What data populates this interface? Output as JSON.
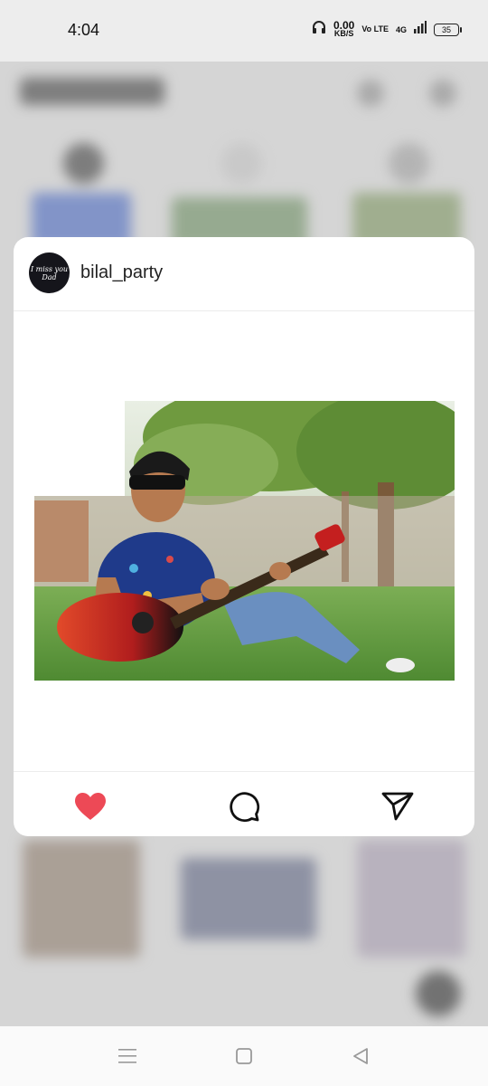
{
  "status_bar": {
    "time": "4:04",
    "speed_value": "0.00",
    "speed_unit": "KB/S",
    "volte": "Vo LTE",
    "network": "4G",
    "battery": "35"
  },
  "preview": {
    "username": "bilal_party",
    "avatar_text": "I miss you Dad",
    "photo_alt": "Man with sunglasses playing a red guitar sitting on grass",
    "actions": [
      "like",
      "comment",
      "share"
    ],
    "like_color": "#ed4956"
  },
  "nav": {
    "icons": [
      "menu-icon",
      "home-square-icon",
      "back-triangle-icon"
    ]
  }
}
